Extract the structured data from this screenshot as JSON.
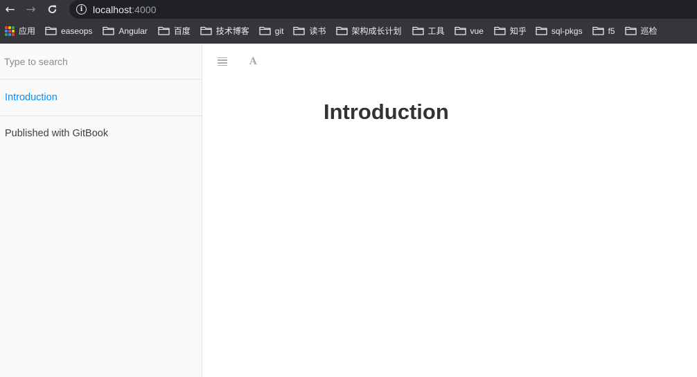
{
  "browser": {
    "url_host": "localhost",
    "url_port": ":4000"
  },
  "bookmarks": [
    {
      "label": "应用",
      "icon": "apps-grid-icon"
    },
    {
      "label": "easeops",
      "icon": "folder-icon"
    },
    {
      "label": "Angular",
      "icon": "folder-icon"
    },
    {
      "label": "百度",
      "icon": "folder-icon"
    },
    {
      "label": "技术博客",
      "icon": "folder-icon"
    },
    {
      "label": "git",
      "icon": "folder-icon"
    },
    {
      "label": "读书",
      "icon": "folder-icon"
    },
    {
      "label": "架构成长计划",
      "icon": "folder-icon"
    },
    {
      "label": "工具",
      "icon": "folder-icon"
    },
    {
      "label": "vue",
      "icon": "folder-icon"
    },
    {
      "label": "知乎",
      "icon": "folder-icon"
    },
    {
      "label": "sql-pkgs",
      "icon": "folder-icon"
    },
    {
      "label": "f5",
      "icon": "folder-icon"
    },
    {
      "label": "巡检",
      "icon": "folder-icon"
    }
  ],
  "colors": {
    "apps": [
      "#ea4335",
      "#fbbc05",
      "#34a853",
      "#4285f4",
      "#ea4335",
      "#fbbc05",
      "#34a853",
      "#4285f4",
      "#ea4335"
    ],
    "link": "#008cff"
  },
  "sidebar": {
    "search_placeholder": "Type to search",
    "summary": [
      {
        "label": "Introduction"
      }
    ],
    "gitbook_link": "Published with GitBook"
  },
  "header": {
    "font_button_glyph": "A"
  },
  "content": {
    "title": "Introduction"
  }
}
